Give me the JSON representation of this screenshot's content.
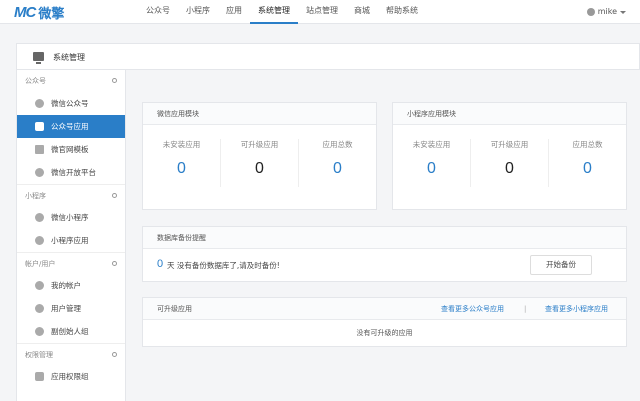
{
  "brand": {
    "mark": "MC",
    "name": "微擎"
  },
  "nav": [
    {
      "label": "公众号"
    },
    {
      "label": "小程序"
    },
    {
      "label": "应用"
    },
    {
      "label": "系统管理"
    },
    {
      "label": "站点管理"
    },
    {
      "label": "商城"
    },
    {
      "label": "帮助系统"
    }
  ],
  "user": {
    "name": "mike"
  },
  "page_title": "系统管理",
  "sidebar": {
    "groups": [
      {
        "title": "公众号",
        "items": [
          {
            "label": "微信公众号"
          },
          {
            "label": "公众号应用"
          },
          {
            "label": "微官网模板"
          },
          {
            "label": "微信开放平台"
          }
        ]
      },
      {
        "title": "小程序",
        "items": [
          {
            "label": "微信小程序"
          },
          {
            "label": "小程序应用"
          }
        ]
      },
      {
        "title": "帐户/用户",
        "items": [
          {
            "label": "我的帐户"
          },
          {
            "label": "用户管理"
          },
          {
            "label": "副创始人组"
          }
        ]
      },
      {
        "title": "权限管理",
        "items": [
          {
            "label": "应用权限组"
          }
        ]
      }
    ]
  },
  "wechat_card": {
    "title": "微信应用模块",
    "stats": [
      {
        "label": "未安装应用",
        "value": "0"
      },
      {
        "label": "可升级应用",
        "value": "0"
      },
      {
        "label": "应用总数",
        "value": "0"
      }
    ]
  },
  "miniapp_card": {
    "title": "小程序应用模块",
    "stats": [
      {
        "label": "未安装应用",
        "value": "0"
      },
      {
        "label": "可升级应用",
        "value": "0"
      },
      {
        "label": "应用总数",
        "value": "0"
      }
    ]
  },
  "backup": {
    "title": "数据库备份提醒",
    "days": "0",
    "text": "天 没有备份数据库了,请及时备份!",
    "button": "开始备份"
  },
  "upgrades": {
    "title": "可升级应用",
    "link_wechat": "查看更多公众号应用",
    "separator": "|",
    "link_miniapp": "查看更多小程序应用",
    "empty": "没有可升级的应用"
  },
  "colors": {
    "accent": "#2a7ec8"
  }
}
